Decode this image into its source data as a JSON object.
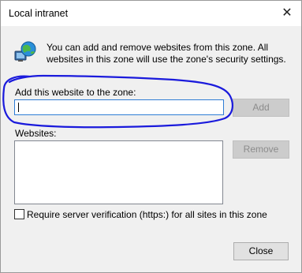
{
  "window": {
    "title": "Local intranet",
    "close_glyph": "✕"
  },
  "intro": {
    "icon": "globe-computer-icon",
    "text": "You can add and remove websites from this zone. All websites in this zone will use the zone's security settings."
  },
  "add_site": {
    "label": "Add this website to the zone:",
    "value": "",
    "button_label": "Add",
    "button_enabled": false
  },
  "websites": {
    "label": "Websites:",
    "items": [],
    "remove_label": "Remove",
    "remove_enabled": false
  },
  "https_requirement": {
    "label": "Require server verification (https:) for all sites in this zone",
    "checked": false
  },
  "footer": {
    "close_label": "Close"
  },
  "colors": {
    "annotation_stroke": "#1a1adc",
    "input_focus_border": "#2f7dd5"
  }
}
